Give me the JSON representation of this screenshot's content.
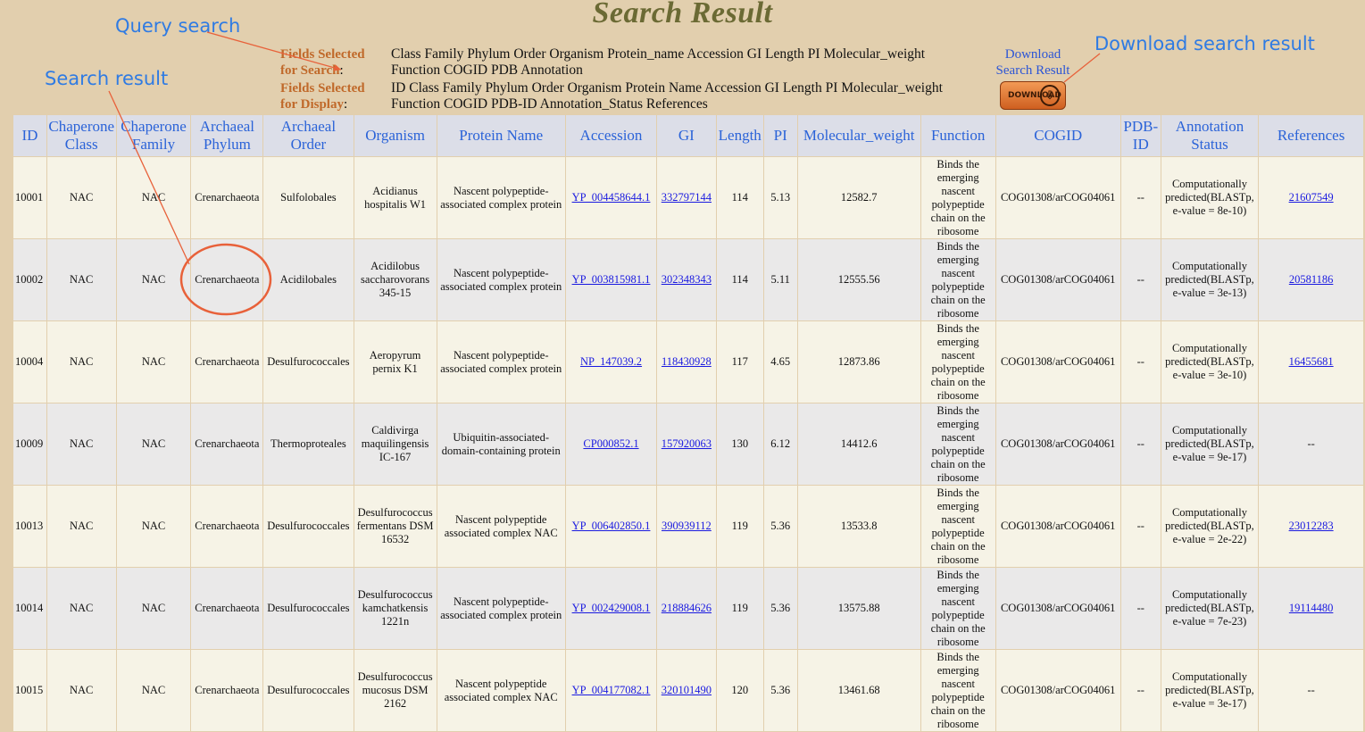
{
  "page_title": "Search Result",
  "annotations": {
    "query_search": "Query search",
    "search_result": "Search result",
    "download_search_result": "Download search result"
  },
  "fields_search": {
    "label_line1": "Fields Selected",
    "label_line2": "for Search",
    "colon": ":",
    "value_line1": "Class Family Phylum Order Organism Protein_name Accession GI Length PI Molecular_weight",
    "value_line2": "Function COGID PDB Annotation"
  },
  "fields_display": {
    "label_line1": "Fields Selected",
    "label_line2": "for Display",
    "colon": ":",
    "value_line1": "ID Class Family Phylum Order Organism Protein Name Accession GI Length PI Molecular_weight",
    "value_line2": "Function COGID PDB-ID Annotation_Status References"
  },
  "download": {
    "link_line1": "Download",
    "link_line2": "Search Result",
    "button_label": "DOWNLOAD",
    "button_icon": "download-arrow-icon"
  },
  "accent_colors": {
    "annotation": "#2f7be3",
    "title": "#6b6a34",
    "header_text": "#2b63d8",
    "circle": "#e8613a"
  },
  "columns": [
    "ID",
    "Chaperone Class",
    "Chaperone Family",
    "Archaeal Phylum",
    "Archaeal Order",
    "Organism",
    "Protein Name",
    "Accession",
    "GI",
    "Length",
    "PI",
    "Molecular_weight",
    "Function",
    "COGID",
    "PDB-ID",
    "Annotation Status",
    "References"
  ],
  "rows": [
    {
      "id": "10001",
      "class": "NAC",
      "family": "NAC",
      "phylum": "Crenarchaeota",
      "order": "Sulfolobales",
      "organism": "Acidianus hospitalis W1",
      "protein": "Nascent polypeptide-associated complex protein",
      "accession": "YP_004458644.1",
      "gi": "332797144",
      "length": "114",
      "pi": "5.13",
      "mw": "12582.7",
      "function": "Binds the emerging nascent polypeptide chain on the ribosome",
      "cogid": "COG01308/arCOG04061",
      "pdb": "--",
      "annotation": "Computationally predicted(BLASTp, e-value = 8e-10)",
      "reference": "21607549"
    },
    {
      "id": "10002",
      "class": "NAC",
      "family": "NAC",
      "phylum": "Crenarchaeota",
      "order": "Acidilobales",
      "organism": "Acidilobus saccharovorans 345-15",
      "protein": "Nascent polypeptide-associated complex protein",
      "accession": "YP_003815981.1",
      "gi": "302348343",
      "length": "114",
      "pi": "5.11",
      "mw": "12555.56",
      "function": "Binds the emerging nascent polypeptide chain on the ribosome",
      "cogid": "COG01308/arCOG04061",
      "pdb": "--",
      "annotation": "Computationally predicted(BLASTp, e-value = 3e-13)",
      "reference": "20581186"
    },
    {
      "id": "10004",
      "class": "NAC",
      "family": "NAC",
      "phylum": "Crenarchaeota",
      "order": "Desulfurococcales",
      "organism": "Aeropyrum pernix K1",
      "protein": "Nascent polypeptide-associated complex protein",
      "accession": "NP_147039.2",
      "gi": "118430928",
      "length": "117",
      "pi": "4.65",
      "mw": "12873.86",
      "function": "Binds the emerging nascent polypeptide chain on the ribosome",
      "cogid": "COG01308/arCOG04061",
      "pdb": "--",
      "annotation": "Computationally predicted(BLASTp, e-value = 3e-10)",
      "reference": "16455681"
    },
    {
      "id": "10009",
      "class": "NAC",
      "family": "NAC",
      "phylum": "Crenarchaeota",
      "order": "Thermoproteales",
      "organism": "Caldivirga maquilingensis IC-167",
      "protein": "Ubiquitin-associated-domain-containing protein",
      "accession": "CP000852.1",
      "gi": "157920063",
      "length": "130",
      "pi": "6.12",
      "mw": "14412.6",
      "function": "Binds the emerging nascent polypeptide chain on the ribosome",
      "cogid": "COG01308/arCOG04061",
      "pdb": "--",
      "annotation": "Computationally predicted(BLASTp, e-value = 9e-17)",
      "reference": "--"
    },
    {
      "id": "10013",
      "class": "NAC",
      "family": "NAC",
      "phylum": "Crenarchaeota",
      "order": "Desulfurococcales",
      "organism": "Desulfurococcus fermentans DSM 16532",
      "protein": "Nascent polypeptide associated complex NAC",
      "accession": "YP_006402850.1",
      "gi": "390939112",
      "length": "119",
      "pi": "5.36",
      "mw": "13533.8",
      "function": "Binds the emerging nascent polypeptide chain on the ribosome",
      "cogid": "COG01308/arCOG04061",
      "pdb": "--",
      "annotation": "Computationally predicted(BLASTp, e-value = 2e-22)",
      "reference": "23012283"
    },
    {
      "id": "10014",
      "class": "NAC",
      "family": "NAC",
      "phylum": "Crenarchaeota",
      "order": "Desulfurococcales",
      "organism": "Desulfurococcus kamchatkensis 1221n",
      "protein": "Nascent polypeptide-associated complex protein",
      "accession": "YP_002429008.1",
      "gi": "218884626",
      "length": "119",
      "pi": "5.36",
      "mw": "13575.88",
      "function": "Binds the emerging nascent polypeptide chain on the ribosome",
      "cogid": "COG01308/arCOG04061",
      "pdb": "--",
      "annotation": "Computationally predicted(BLASTp, e-value = 7e-23)",
      "reference": "19114480"
    },
    {
      "id": "10015",
      "class": "NAC",
      "family": "NAC",
      "phylum": "Crenarchaeota",
      "order": "Desulfurococcales",
      "organism": "Desulfurococcus mucosus DSM 2162",
      "protein": "Nascent polypeptide associated complex NAC",
      "accession": "YP_004177082.1",
      "gi": "320101490",
      "length": "120",
      "pi": "5.36",
      "mw": "13461.68",
      "function": "Binds the emerging nascent polypeptide chain on the ribosome",
      "cogid": "COG01308/arCOG04061",
      "pdb": "--",
      "annotation": "Computationally predicted(BLASTp, e-value = 3e-17)",
      "reference": "--"
    }
  ]
}
